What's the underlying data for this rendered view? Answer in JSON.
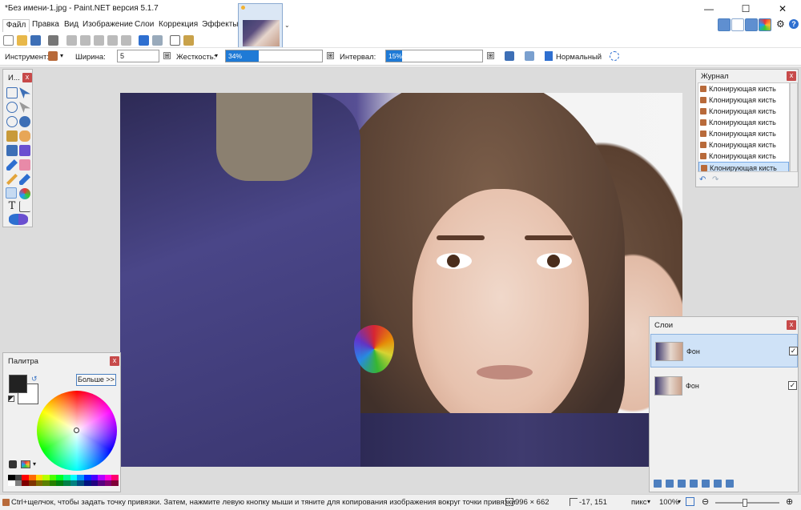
{
  "window": {
    "title": "*Без имени-1.jpg - Paint.NET версия 5.1.7",
    "minimize_glyph": "—",
    "maximize_glyph": "☐",
    "close_glyph": "✕"
  },
  "menu": {
    "items": [
      "Файл",
      "Правка",
      "Вид",
      "Изображение",
      "Слои",
      "Коррекция",
      "Эффекты"
    ]
  },
  "image_tab": {
    "dropdown_glyph": "⌄"
  },
  "toolbar2": {
    "tool_label": "Инструмент:",
    "width_label": "Ширина:",
    "width_value": "5",
    "hardness_label": "Жесткость:",
    "hardness_value": "34%",
    "hardness_fraction": 0.34,
    "interval_label": "Интервал:",
    "interval_value": "15%",
    "interval_fraction": 0.15,
    "blend_mode": "Нормальный",
    "plus_glyph": "⊞"
  },
  "tools_panel": {
    "title": "И...",
    "close": "x",
    "text_tool": "T"
  },
  "palette_panel": {
    "title": "Палитра",
    "close": "x",
    "more_button": "Больше >>",
    "primary_color": "#222222",
    "secondary_color": "#ffffff"
  },
  "history_panel": {
    "title": "Журнал",
    "close": "x",
    "items": [
      "Клонирующая кисть",
      "Клонирующая кисть",
      "Клонирующая кисть",
      "Клонирующая кисть",
      "Клонирующая кисть",
      "Клонирующая кисть",
      "Клонирующая кисть",
      "Клонирующая кисть"
    ],
    "undo_glyph": "↶",
    "redo_glyph": "↷"
  },
  "layers_panel": {
    "title": "Слои",
    "close": "x",
    "layers": [
      {
        "name": "Фон",
        "visible_glyph": "✓"
      },
      {
        "name": "Фон",
        "visible_glyph": "✓"
      }
    ]
  },
  "statusbar": {
    "hint": "Ctrl+щелчок, чтобы задать точку привязки. Затем, нажмите левую кнопку мыши и тяните для копирования изображения вокруг точки привязки.",
    "image_size": "996 × 662",
    "cursor_position": "-17, 151",
    "units": "пикс",
    "zoom": "100%"
  },
  "colors": {
    "accent": "#1f7ad6",
    "panel_bg": "#f0f0f0",
    "workspace_bg": "#dcdcdc",
    "close_red": "#c74a4a"
  }
}
